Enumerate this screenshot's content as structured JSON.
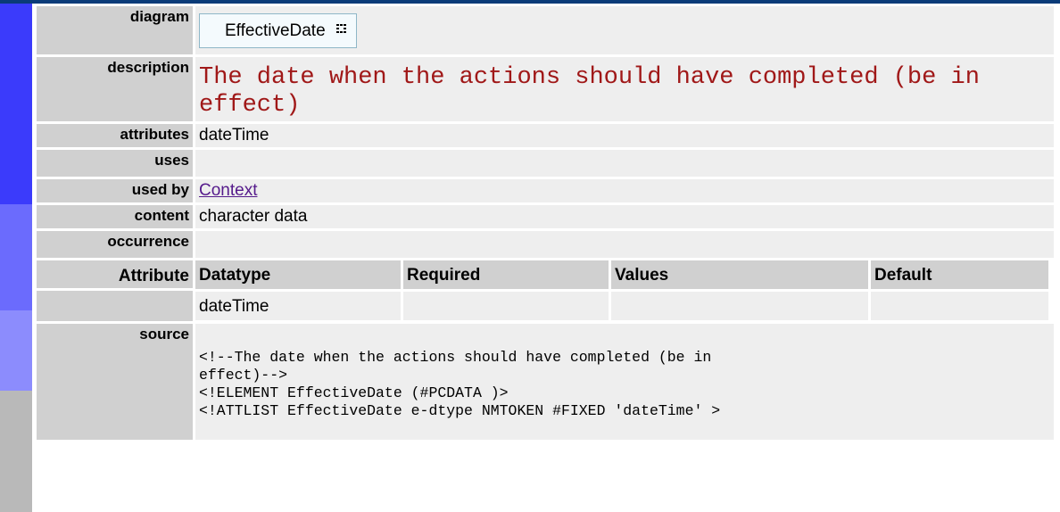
{
  "labels": {
    "diagram": "diagram",
    "description": "description",
    "attributes": "attributes",
    "uses": "uses",
    "used_by": "used by",
    "content": "content",
    "occurrence": "occurrence",
    "attribute": "Attribute",
    "source": "source"
  },
  "element": {
    "diagram_name": "EffectiveDate",
    "description": "The date when the actions should have completed (be in effect)",
    "attributes": "dateTime",
    "uses": "",
    "used_by": "Context",
    "content": "character data",
    "occurrence": ""
  },
  "attribute_table": {
    "headers": [
      "Datatype",
      "Required",
      "Values",
      "Default"
    ],
    "rows": [
      {
        "name": "",
        "datatype": "dateTime",
        "required": "",
        "values": "",
        "default": ""
      }
    ]
  },
  "source": "<!--The date when the actions should have completed (be in\neffect)-->\n<!ELEMENT EffectiveDate (#PCDATA )>\n<!ATTLIST EffectiveDate e-dtype NMTOKEN #FIXED 'dateTime' >",
  "colors": {
    "topbar": "#0a3b78",
    "sidebar_elements": "#3b3bfb",
    "sidebar_relations": "#6b6bfd",
    "sidebar_attributes": "#8c8cfd",
    "sidebar_source": "#b9b9b9",
    "label_bg": "#d0d0d0",
    "value_bg": "#eeeeee",
    "description_text": "#a01818",
    "link": "#551a8b"
  },
  "icons": {
    "diagram_glyph": "grid-icon"
  }
}
